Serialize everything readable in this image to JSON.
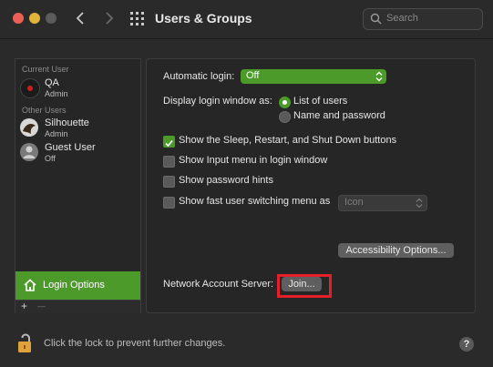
{
  "window": {
    "title": "Users & Groups",
    "search_placeholder": "Search"
  },
  "sidebar": {
    "current_user_header": "Current User",
    "other_users_header": "Other Users",
    "users": [
      {
        "name": "QA",
        "role": "Admin"
      },
      {
        "name": "Silhouette",
        "role": "Admin"
      },
      {
        "name": "Guest User",
        "role": "Off"
      }
    ],
    "login_options_label": "Login Options",
    "add_label": "+",
    "remove_label": "—"
  },
  "main": {
    "automatic_login_label": "Automatic login:",
    "automatic_login_value": "Off",
    "display_login_label": "Display login window as:",
    "radio_list_label": "List of users",
    "radio_name_label": "Name and password",
    "chk_sleep_label": "Show the Sleep, Restart, and Shut Down buttons",
    "chk_input_label": "Show Input menu in login window",
    "chk_hints_label": "Show password hints",
    "chk_fast_label": "Show fast user switching menu as",
    "fast_popup_value": "Icon",
    "accessibility_button": "Accessibility Options...",
    "network_label": "Network Account Server:",
    "join_button": "Join..."
  },
  "footer": {
    "lock_text": "Click the lock to prevent further changes.",
    "help_label": "?"
  },
  "colors": {
    "accent": "#4c9a2a",
    "highlight": "#e5202b"
  }
}
